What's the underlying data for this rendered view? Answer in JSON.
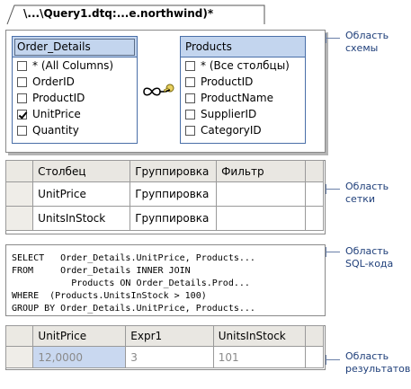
{
  "document": {
    "title": "\\...\\Query1.dtq:...e.northwind)*"
  },
  "diagram": {
    "tables": [
      {
        "name": "Order_Details",
        "columns": [
          {
            "label": "* (All Columns)",
            "checked": false
          },
          {
            "label": "OrderID",
            "checked": false
          },
          {
            "label": "ProductID",
            "checked": false
          },
          {
            "label": "UnitPrice",
            "checked": true
          },
          {
            "label": "Quantity",
            "checked": false
          }
        ]
      },
      {
        "name": "Products",
        "columns": [
          {
            "label": "* (Все столбцы)",
            "checked": false
          },
          {
            "label": "ProductID",
            "checked": false
          },
          {
            "label": "ProductName",
            "checked": false
          },
          {
            "label": "SupplierID",
            "checked": false
          },
          {
            "label": "CategoryID",
            "checked": false
          }
        ]
      }
    ],
    "join_icon": "key-infinity-join-icon"
  },
  "criteria_grid": {
    "headers": [
      "Столбец",
      "Группировка",
      "Фильтр"
    ],
    "rows": [
      [
        "UnitPrice",
        "Группировка",
        ""
      ],
      [
        "UnitsInStock",
        "Группировка",
        ""
      ]
    ]
  },
  "sql": {
    "text": "SELECT   Order_Details.UnitPrice, Products...\nFROM     Order_Details INNER JOIN\n           Products ON Order_Details.Prod...\nWHERE  (Products.UnitsInStock > 100)\nGROUP BY Order_Details.UnitPrice, Products..."
  },
  "results_grid": {
    "headers": [
      "UnitPrice",
      "Expr1",
      "UnitsInStock"
    ],
    "rows": [
      [
        "12,0000",
        "3",
        "101"
      ]
    ]
  },
  "callouts": {
    "diagram": [
      "Область",
      "схемы"
    ],
    "grid": [
      "Область",
      "сетки"
    ],
    "sql": [
      "Область",
      "SQL-кода"
    ],
    "results": [
      "Область",
      "результатов"
    ]
  },
  "colors": {
    "accent": "#4a6fa8",
    "table_header": "#c3d5ee",
    "callout_text": "#1f3f7a",
    "selected_cell": "#c9d8f0"
  }
}
